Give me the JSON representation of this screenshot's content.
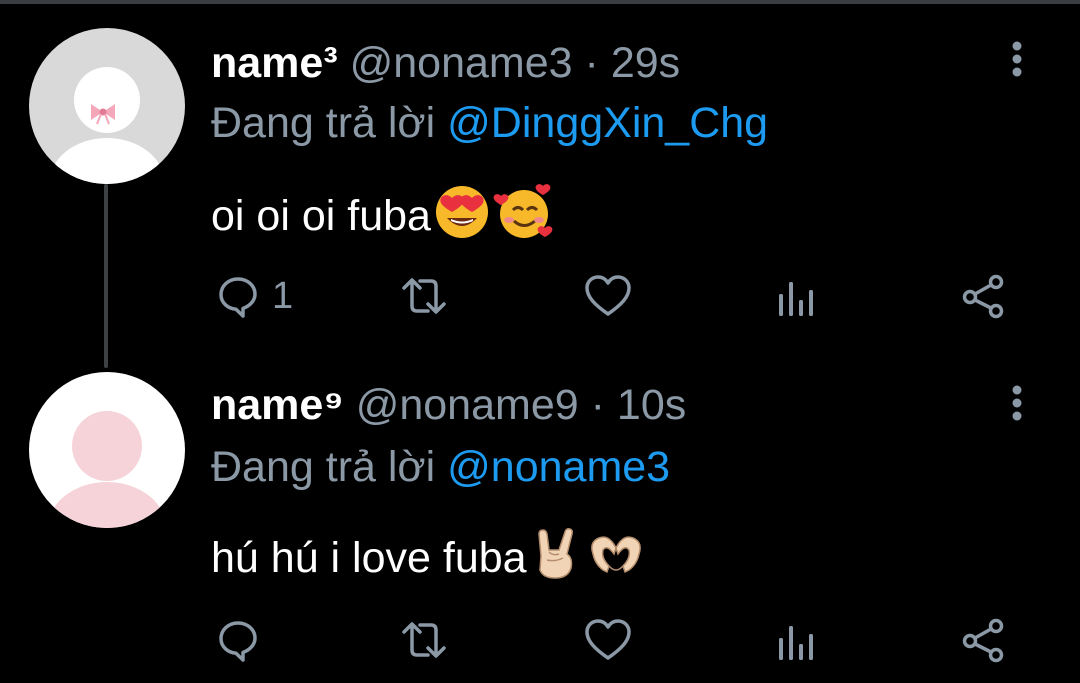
{
  "tweets": [
    {
      "name": "name³",
      "handle": "@noname3",
      "separator": "·",
      "time": "29s",
      "replying_prefix": "Đang trả lời",
      "replying_to": "@DinggXin_Chg",
      "text": "oi oi oi fuba",
      "emojis": [
        "smiling-face-with-heart-eyes",
        "smiling-face-with-hearts"
      ],
      "reply_count": "1",
      "avatar_icon": "default-avatar-with-pink-bow"
    },
    {
      "name": "name⁹",
      "handle": "@noname9",
      "separator": "·",
      "time": "10s",
      "replying_prefix": "Đang trả lời",
      "replying_to": "@noname3",
      "text": "hú hú i love fuba",
      "emojis": [
        "sign-of-the-horns",
        "heart-hands"
      ],
      "reply_count": "",
      "avatar_icon": "default-avatar-pink"
    }
  ],
  "actions": [
    "reply-icon",
    "retweet-icon",
    "like-icon",
    "analytics-icon",
    "share-icon"
  ],
  "colors": {
    "background": "#000000",
    "name": "#ffffff",
    "secondary": "#8b98a5",
    "mention": "#1d9bf0",
    "thread_line": "#3e4144"
  }
}
